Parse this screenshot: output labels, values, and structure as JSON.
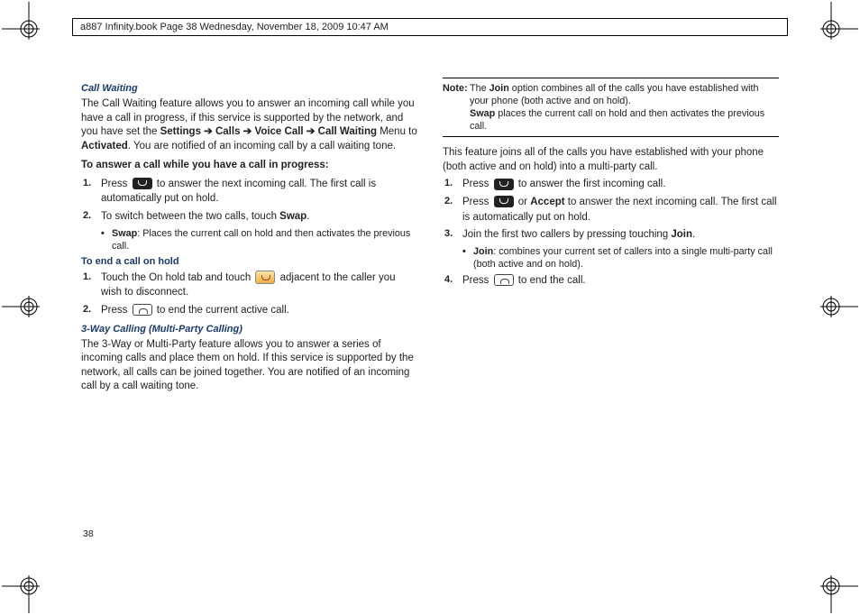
{
  "header": "a887 Infinity.book  Page 38  Wednesday, November 18, 2009  10:47 AM",
  "pageNumber": "38",
  "left": {
    "h1": "Call Waiting",
    "p1a": "The Call Waiting feature allows you to answer an incoming call while you have a call in progress, if this service is supported by the network, and you have set the ",
    "p1b": "Settings ➔ Calls ➔ Voice Call ➔ Call Waiting",
    "p1c": " Menu to ",
    "p1d": "Activated",
    "p1e": ". You are notified of an incoming call by a call waiting tone.",
    "lead1": "To answer a call while you have a call in progress:",
    "li1a": "Press ",
    "li1b": " to answer the next incoming call. The first call is automatically put on hold.",
    "li2a": "To switch between the two calls, touch ",
    "li2b": "Swap",
    "li2c": ".",
    "bul1a": "Swap",
    "bul1b": ": Places the current call on hold and then activates the previous call.",
    "h2": "To end a call on hold",
    "li3a": "Touch the On hold tab and touch ",
    "li3b": " adjacent to the caller you wish to disconnect.",
    "li4a": "Press ",
    "li4b": " to end the current active call.",
    "h3": "3-Way Calling (Multi-Party Calling)",
    "p2": "The 3-Way or Multi-Party feature allows you to answer a series of incoming calls and place them on hold. If this service is supported by the network, all calls can be joined together. You are notified of an incoming call by a call waiting tone."
  },
  "right": {
    "noteLabel": "Note:",
    "note1a": "The ",
    "note1b": "Join",
    "note1c": " option combines all of the calls you have established with your phone (both active and on hold).",
    "note2a": "Swap",
    "note2b": " places the current call on hold and then activates the previous call.",
    "p1": "This feature joins all of the calls you have established with your phone (both active and on hold) into a multi-party call.",
    "li1a": "Press ",
    "li1b": " to answer the first incoming call.",
    "li2a": "Press ",
    "li2b": " or ",
    "li2c": "Accept",
    "li2d": " to answer the next incoming call. The first call is automatically put on hold.",
    "li3a": "Join the first two callers by pressing touching ",
    "li3b": "Join",
    "li3c": ".",
    "bul1a": "Join",
    "bul1b": ": combines your current set of callers into a single multi-party call (both active and on hold).",
    "li4a": "Press ",
    "li4b": " to end the call."
  }
}
